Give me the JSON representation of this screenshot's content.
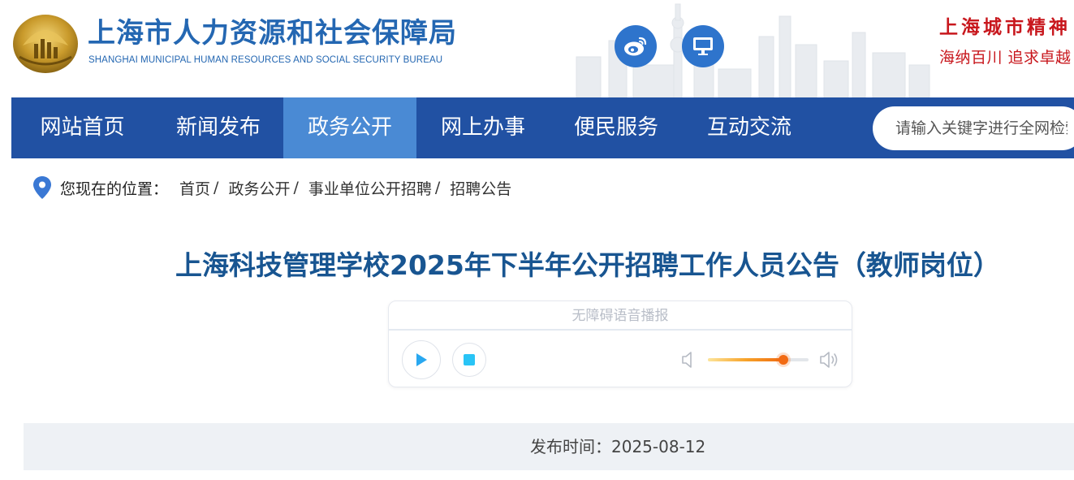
{
  "header": {
    "org_name_cn": "上海市人力资源和社会保障局",
    "org_name_en": "SHANGHAI MUNICIPAL HUMAN RESOURCES AND SOCIAL SECURITY BUREAU",
    "icons": [
      "weibo-icon",
      "desktop-icon"
    ],
    "slogan_line1": "上海城市精神",
    "slogan_line2": "海纳百川 追求卓越"
  },
  "nav": {
    "items": [
      "网站首页",
      "新闻发布",
      "政务公开",
      "网上办事",
      "便民服务",
      "互动交流"
    ],
    "active_index": 2
  },
  "search": {
    "placeholder": "请输入关键字进行全网检索"
  },
  "breadcrumb": {
    "prefix": "您现在的位置：",
    "items": [
      "首页",
      "政务公开",
      "事业单位公开招聘",
      "招聘公告"
    ],
    "separator": "/"
  },
  "article": {
    "title": "上海科技管理学校2025年下半年公开招聘工作人员公告（教师岗位）",
    "publish_label": "发布时间：2025-08-12"
  },
  "player": {
    "header": "无障碍语音播报",
    "volume": 0.75,
    "accent": "#29a8f0"
  },
  "colors": {
    "nav_bg": "#2151a3",
    "nav_active": "#4a8ad4",
    "title": "#185591",
    "slogan": "#c8171d"
  }
}
